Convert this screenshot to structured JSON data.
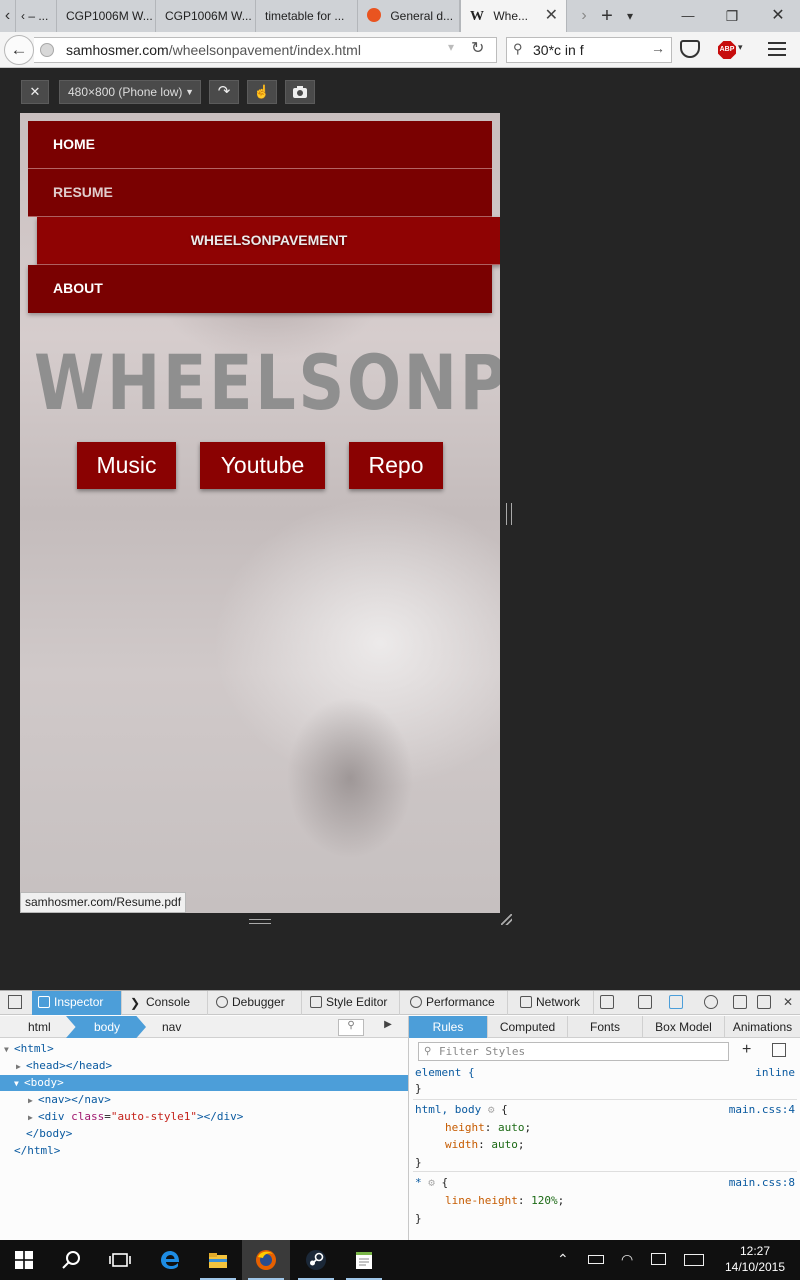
{
  "browser": {
    "tabs": [
      {
        "title": "‹ – ..."
      },
      {
        "title": "CGP1006M W..."
      },
      {
        "title": "CGP1006M W..."
      },
      {
        "title": "timetable for ..."
      },
      {
        "title": "General d..."
      },
      {
        "title": "Whe..."
      }
    ],
    "close_tab": "✕",
    "new_tab": "+",
    "tab_list": "›",
    "tab_dropdown": "▾",
    "window_min": "—",
    "window_restore": "❐",
    "window_close": "✕",
    "url_host": "samhosmer.com",
    "url_path": "/wheelsonpavement/index.html",
    "search_value": "30*c in f",
    "back": "←",
    "reload": "↻",
    "go": "→"
  },
  "rdm": {
    "close": "✕",
    "device": "480×800 (Phone low)",
    "rotate": "↷",
    "touch": "☝",
    "screenshot": "📷"
  },
  "page": {
    "nav": [
      {
        "label": "HOME"
      },
      {
        "label": "RESUME"
      },
      {
        "label": "WHEELSONPAVEMENT"
      },
      {
        "label": "ABOUT"
      }
    ],
    "hero_title": "WHEELSONPAVEMENT",
    "buttons": [
      {
        "label": "Music"
      },
      {
        "label": "Youtube"
      },
      {
        "label": "Repo"
      }
    ],
    "status_link": "samhosmer.com/Resume.pdf",
    "background_color": "#c8c0c0",
    "accent_color": "#7a0101"
  },
  "devtools": {
    "tabs": [
      {
        "label": "Inspector"
      },
      {
        "label": "Console"
      },
      {
        "label": "Debugger"
      },
      {
        "label": "Style Editor"
      },
      {
        "label": "Performance"
      },
      {
        "label": "Network"
      }
    ],
    "close": "✕",
    "breadcrumbs": [
      {
        "label": "html"
      },
      {
        "label": "body"
      },
      {
        "label": "nav"
      }
    ],
    "markup": {
      "html_open": "<html>",
      "head": "<head></head>",
      "body_open": "<body>",
      "nav": "<nav></nav>",
      "div_open": "<div ",
      "div_attr": "class",
      "div_eq": "=",
      "div_val": "\"auto-style1\"",
      "div_close": "></div>",
      "body_close": "</body>",
      "html_close": "</html>"
    },
    "side_tabs": [
      {
        "label": "Rules"
      },
      {
        "label": "Computed"
      },
      {
        "label": "Fonts"
      },
      {
        "label": "Box Model"
      },
      {
        "label": "Animations"
      }
    ],
    "filter_placeholder": "Filter Styles",
    "add_rule": "+",
    "rules": {
      "r1_selector": "element {",
      "r1_close": "}",
      "r1_source": "inline",
      "r2_selector": "html, body",
      "r2_open": "{",
      "r2_source": "main.css:4",
      "r2_p1": "height",
      "r2_v1": "auto",
      "r2_p2": "width",
      "r2_v2": "auto",
      "r2_close": "}",
      "r3_selector": "*",
      "r3_open": "{",
      "r3_source": "main.css:8",
      "r3_p1": "line-height",
      "r3_v1": "120%",
      "r3_close": "}"
    }
  },
  "taskbar": {
    "time": "12:27",
    "date": "14/10/2015"
  }
}
